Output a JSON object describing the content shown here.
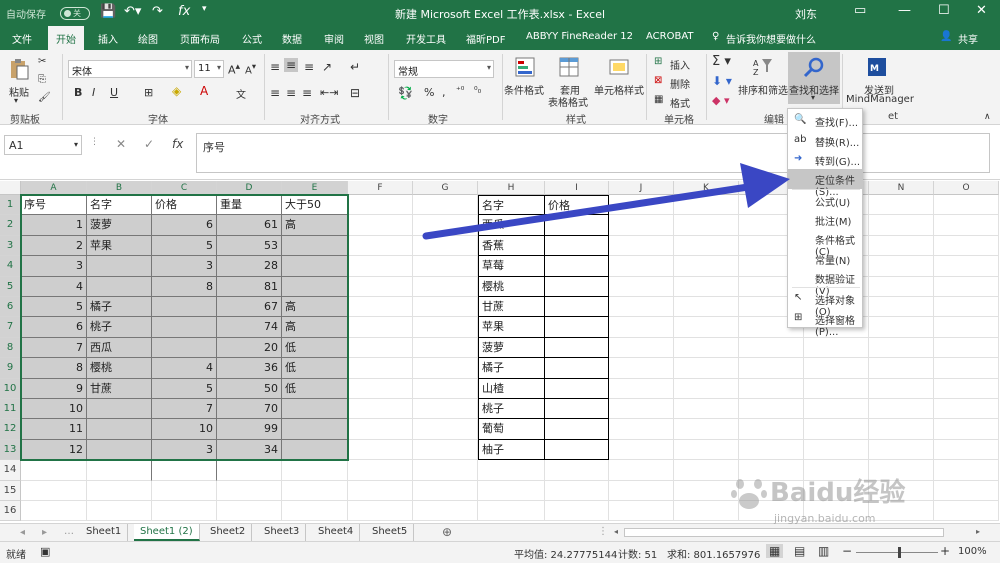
{
  "titlebar": {
    "autosave": "自动保存",
    "toggle": "关",
    "title": "新建 Microsoft Excel 工作表.xlsx - Excel",
    "user": "刘东"
  },
  "tabs": [
    "文件",
    "开始",
    "插入",
    "绘图",
    "页面布局",
    "公式",
    "数据",
    "审阅",
    "视图",
    "开发工具",
    "福昕PDF",
    "ABBYY FineReader 12",
    "ACROBAT"
  ],
  "tellme": "告诉我你想要做什么",
  "share": "共享",
  "ribbon": {
    "paste": "粘贴",
    "font_name": "宋体",
    "font_size": "11",
    "number_format": "常规",
    "cond_format": "条件格式",
    "table_format_1": "套用",
    "table_format_2": "表格格式",
    "cell_style": "单元格样式",
    "insert": "插入",
    "delete": "删除",
    "format": "格式",
    "sort_filter": "排序和筛选",
    "find_select": "查找和选择",
    "send_1": "发送到",
    "send_2": "MindManager",
    "groups": {
      "clipboard": "剪贴板",
      "font": "字体",
      "align": "对齐方式",
      "number": "数字",
      "styles": "样式",
      "cells": "单元格",
      "editing": "编辑",
      "send": "et"
    }
  },
  "namebox": "A1",
  "formula": "序号",
  "columns": [
    "A",
    "B",
    "C",
    "D",
    "E",
    "F",
    "G",
    "H",
    "I",
    "J",
    "K",
    "L",
    "M",
    "N",
    "O"
  ],
  "rows": [
    "1",
    "2",
    "3",
    "4",
    "5",
    "6",
    "7",
    "8",
    "9",
    "10",
    "11",
    "12",
    "13",
    "14",
    "15",
    "16"
  ],
  "table1": [
    [
      "序号",
      "名字",
      "价格",
      "重量",
      "大于50"
    ],
    [
      "1",
      "菠萝",
      "6",
      "61",
      "高"
    ],
    [
      "2",
      "苹果",
      "5",
      "53",
      ""
    ],
    [
      "3",
      "",
      "3",
      "28",
      ""
    ],
    [
      "4",
      "",
      "8",
      "81",
      ""
    ],
    [
      "5",
      "橘子",
      "",
      "67",
      "高"
    ],
    [
      "6",
      "桃子",
      "",
      "74",
      "高"
    ],
    [
      "7",
      "西瓜",
      "",
      "20",
      "低"
    ],
    [
      "8",
      "樱桃",
      "4",
      "36",
      "低"
    ],
    [
      "9",
      "甘蔗",
      "5",
      "50",
      "低"
    ],
    [
      "10",
      "",
      "7",
      "70",
      ""
    ],
    [
      "11",
      "",
      "10",
      "99",
      ""
    ],
    [
      "12",
      "",
      "3",
      "34",
      ""
    ]
  ],
  "table2": [
    [
      "名字",
      "价格"
    ],
    [
      "西瓜",
      ""
    ],
    [
      "香蕉",
      ""
    ],
    [
      "草莓",
      ""
    ],
    [
      "樱桃",
      ""
    ],
    [
      "甘蔗",
      ""
    ],
    [
      "苹果",
      ""
    ],
    [
      "菠萝",
      ""
    ],
    [
      "橘子",
      ""
    ],
    [
      "山楂",
      ""
    ],
    [
      "桃子",
      ""
    ],
    [
      "葡萄",
      ""
    ],
    [
      "柚子",
      ""
    ]
  ],
  "menu": [
    "查找(F)...",
    "替换(R)...",
    "转到(G)...",
    "定位条件(S)...",
    "公式(U)",
    "批注(M)",
    "条件格式(C)",
    "常量(N)",
    "数据验证(V)",
    "选择对象(O)",
    "选择窗格(P)..."
  ],
  "sheets": [
    "Sheet1",
    "Sheet1 (2)",
    "Sheet2",
    "Sheet3",
    "Sheet4",
    "Sheet5"
  ],
  "status": {
    "ready": "就绪",
    "average": "平均值: 24.27775144",
    "count": "计数: 51",
    "sum": "求和: 801.1657976",
    "zoom": "100%"
  },
  "watermark": {
    "big": "Baidu经验",
    "small": "jingyan.baidu.com"
  },
  "colors": {
    "accent": "#217346",
    "arrow": "#3a47c4"
  }
}
